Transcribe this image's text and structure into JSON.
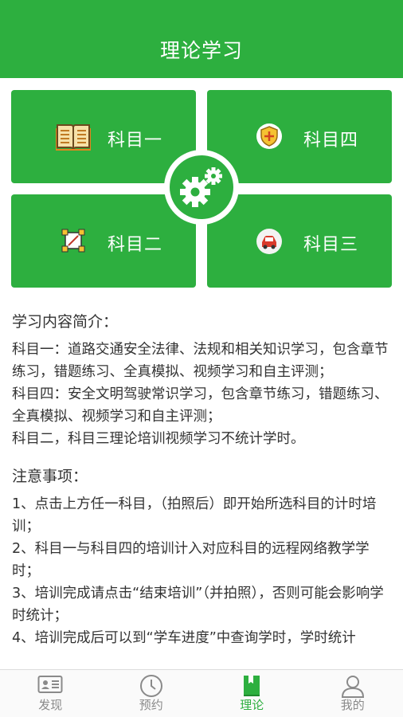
{
  "header": {
    "title": "理论学习"
  },
  "tiles": [
    {
      "label": "科目一",
      "icon": "open-book-icon"
    },
    {
      "label": "科目四",
      "icon": "shield-plus-icon"
    },
    {
      "label": "科目二",
      "icon": "crop-frame-icon"
    },
    {
      "label": "科目三",
      "icon": "car-icon"
    }
  ],
  "hub": {
    "icon": "gears-icon"
  },
  "intro": {
    "heading": "学习内容简介：",
    "lines": [
      "科目一：道路交通安全法律、法规和相关知识学习，包含章节练习，错题练习、全真模拟、视频学习和自主评测；",
      "科目四：安全文明驾驶常识学习，包含章节练习，错题练习、全真模拟、视频学习和自主评测；",
      "科目二，科目三理论培训视频学习不统计学时。"
    ]
  },
  "notes": {
    "heading": "注意事项：",
    "lines": [
      "1、点击上方任一科目，（拍照后）即开始所选科目的计时培训；",
      "2、科目一与科目四的培训计入对应科目的远程网络教学学时；",
      "3、培训完成请点击“结束培训”（并拍照），否则可能会影响学时统计；",
      "4、培训完成后可以到“学车进度”中查询学时，学时统计"
    ]
  },
  "tabbar": {
    "items": [
      {
        "label": "发现",
        "icon": "id-card-icon",
        "active": false
      },
      {
        "label": "预约",
        "icon": "clock-icon",
        "active": false
      },
      {
        "label": "理论",
        "icon": "book-icon",
        "active": true
      },
      {
        "label": "我的",
        "icon": "person-icon",
        "active": false
      }
    ]
  },
  "colors": {
    "brand": "#2daf3f",
    "text": "#333333",
    "tab_inactive": "#8a8a8a"
  }
}
